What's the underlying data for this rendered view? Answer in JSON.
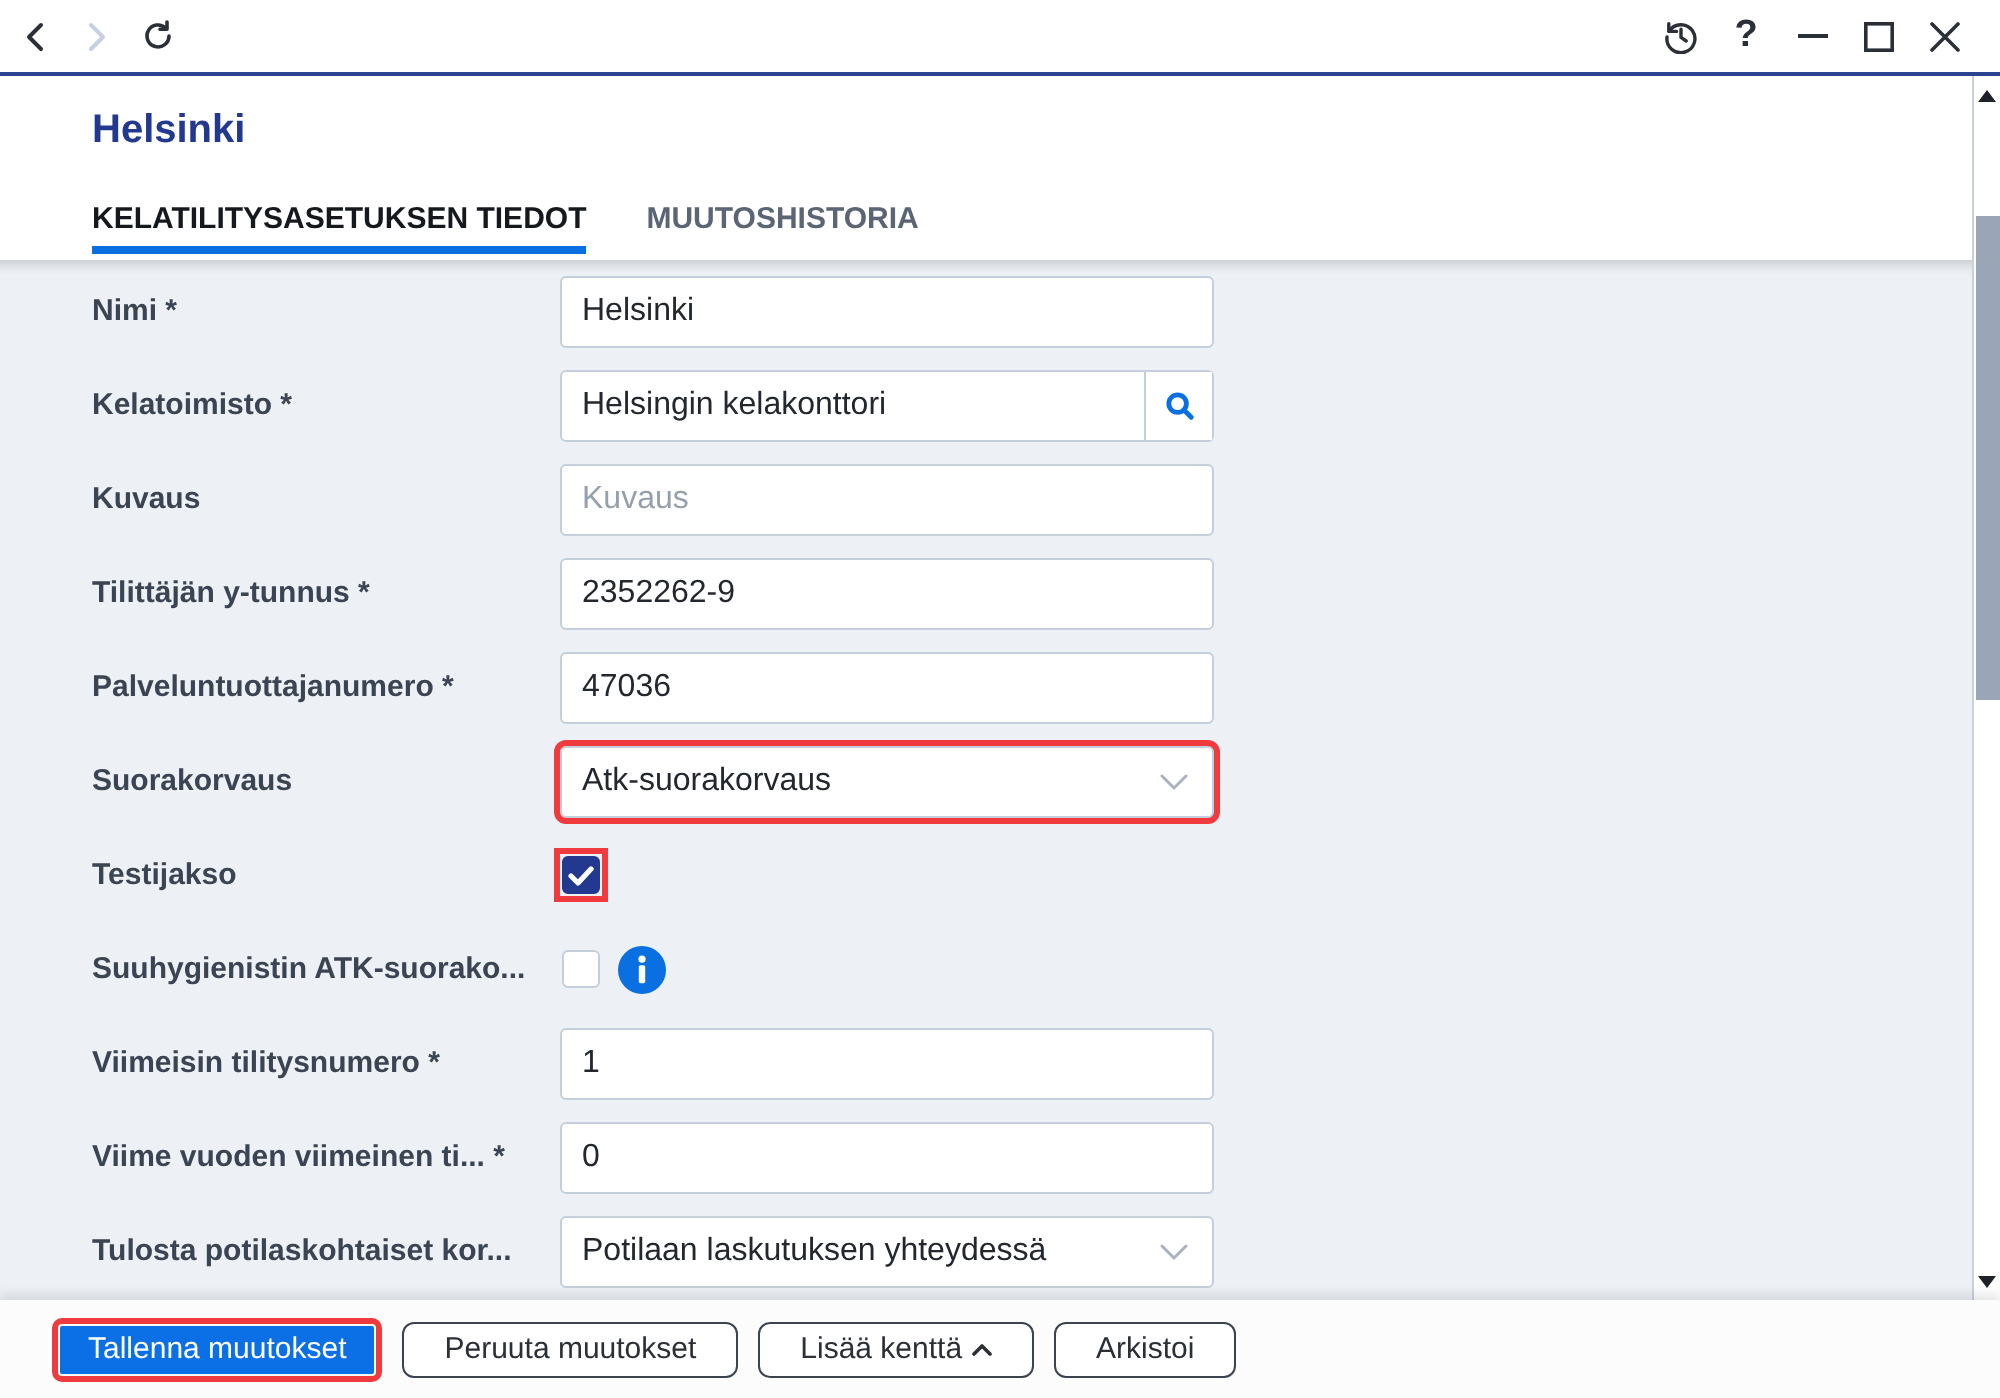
{
  "toolbar": {
    "navigation": [
      {
        "kind": "back",
        "disabled": false
      },
      {
        "kind": "forward",
        "disabled": true
      },
      {
        "kind": "refresh",
        "disabled": false
      }
    ],
    "help": "?"
  },
  "header": {
    "title": "Helsinki"
  },
  "tabs": [
    {
      "label": "KELATILITYSASETUKSEN TIEDOT",
      "selected": true
    },
    {
      "label": "MUUTOSHISTORIA",
      "selected": false
    }
  ],
  "form": {
    "fields": [
      {
        "kind": "text",
        "label": "Nimi *",
        "value": "Helsinki",
        "highlighted": false,
        "info": false
      },
      {
        "kind": "lookup",
        "label": "Kelatoimisto *",
        "value": "Helsingin kelakonttori",
        "highlighted": false,
        "info": false
      },
      {
        "kind": "text",
        "label": "Kuvaus",
        "placeholder": "Kuvaus",
        "highlighted": false,
        "info": false
      },
      {
        "kind": "text",
        "label": "Tilittäjän y-tunnus *",
        "value": "2352262-9",
        "highlighted": false,
        "info": false
      },
      {
        "kind": "text",
        "label": "Palveluntuottajanumero *",
        "value": "47036",
        "highlighted": false,
        "info": false
      },
      {
        "kind": "select",
        "label": "Suorakorvaus",
        "value": "Atk-suorakorvaus",
        "highlighted": true,
        "info": false
      },
      {
        "kind": "checkbox",
        "label": "Testijakso",
        "checked": true,
        "highlighted": true,
        "info": false
      },
      {
        "kind": "checkbox",
        "label": "Suuhygienistin ATK-suorako...",
        "checked": false,
        "highlighted": false,
        "info": true
      },
      {
        "kind": "text",
        "label": "Viimeisin tilitysnumero *",
        "value": "1",
        "highlighted": false,
        "info": false
      },
      {
        "kind": "text",
        "label": "Viime vuoden viimeinen ti... *",
        "value": "0",
        "highlighted": false,
        "info": false
      },
      {
        "kind": "select",
        "label": "Tulosta potilaskohtaiset kor...",
        "value": "Potilaan laskutuksen yhteydessä",
        "highlighted": false,
        "info": false
      }
    ]
  },
  "actions": [
    {
      "kind": "primary",
      "label": "Tallenna muutokset",
      "highlighted": true
    },
    {
      "kind": "secondary",
      "label": "Peruuta muutokset",
      "highlighted": false
    },
    {
      "kind": "menu",
      "label": "Lisää kenttä",
      "highlighted": false
    },
    {
      "kind": "secondary",
      "label": "Arkistoi",
      "highlighted": false
    }
  ]
}
